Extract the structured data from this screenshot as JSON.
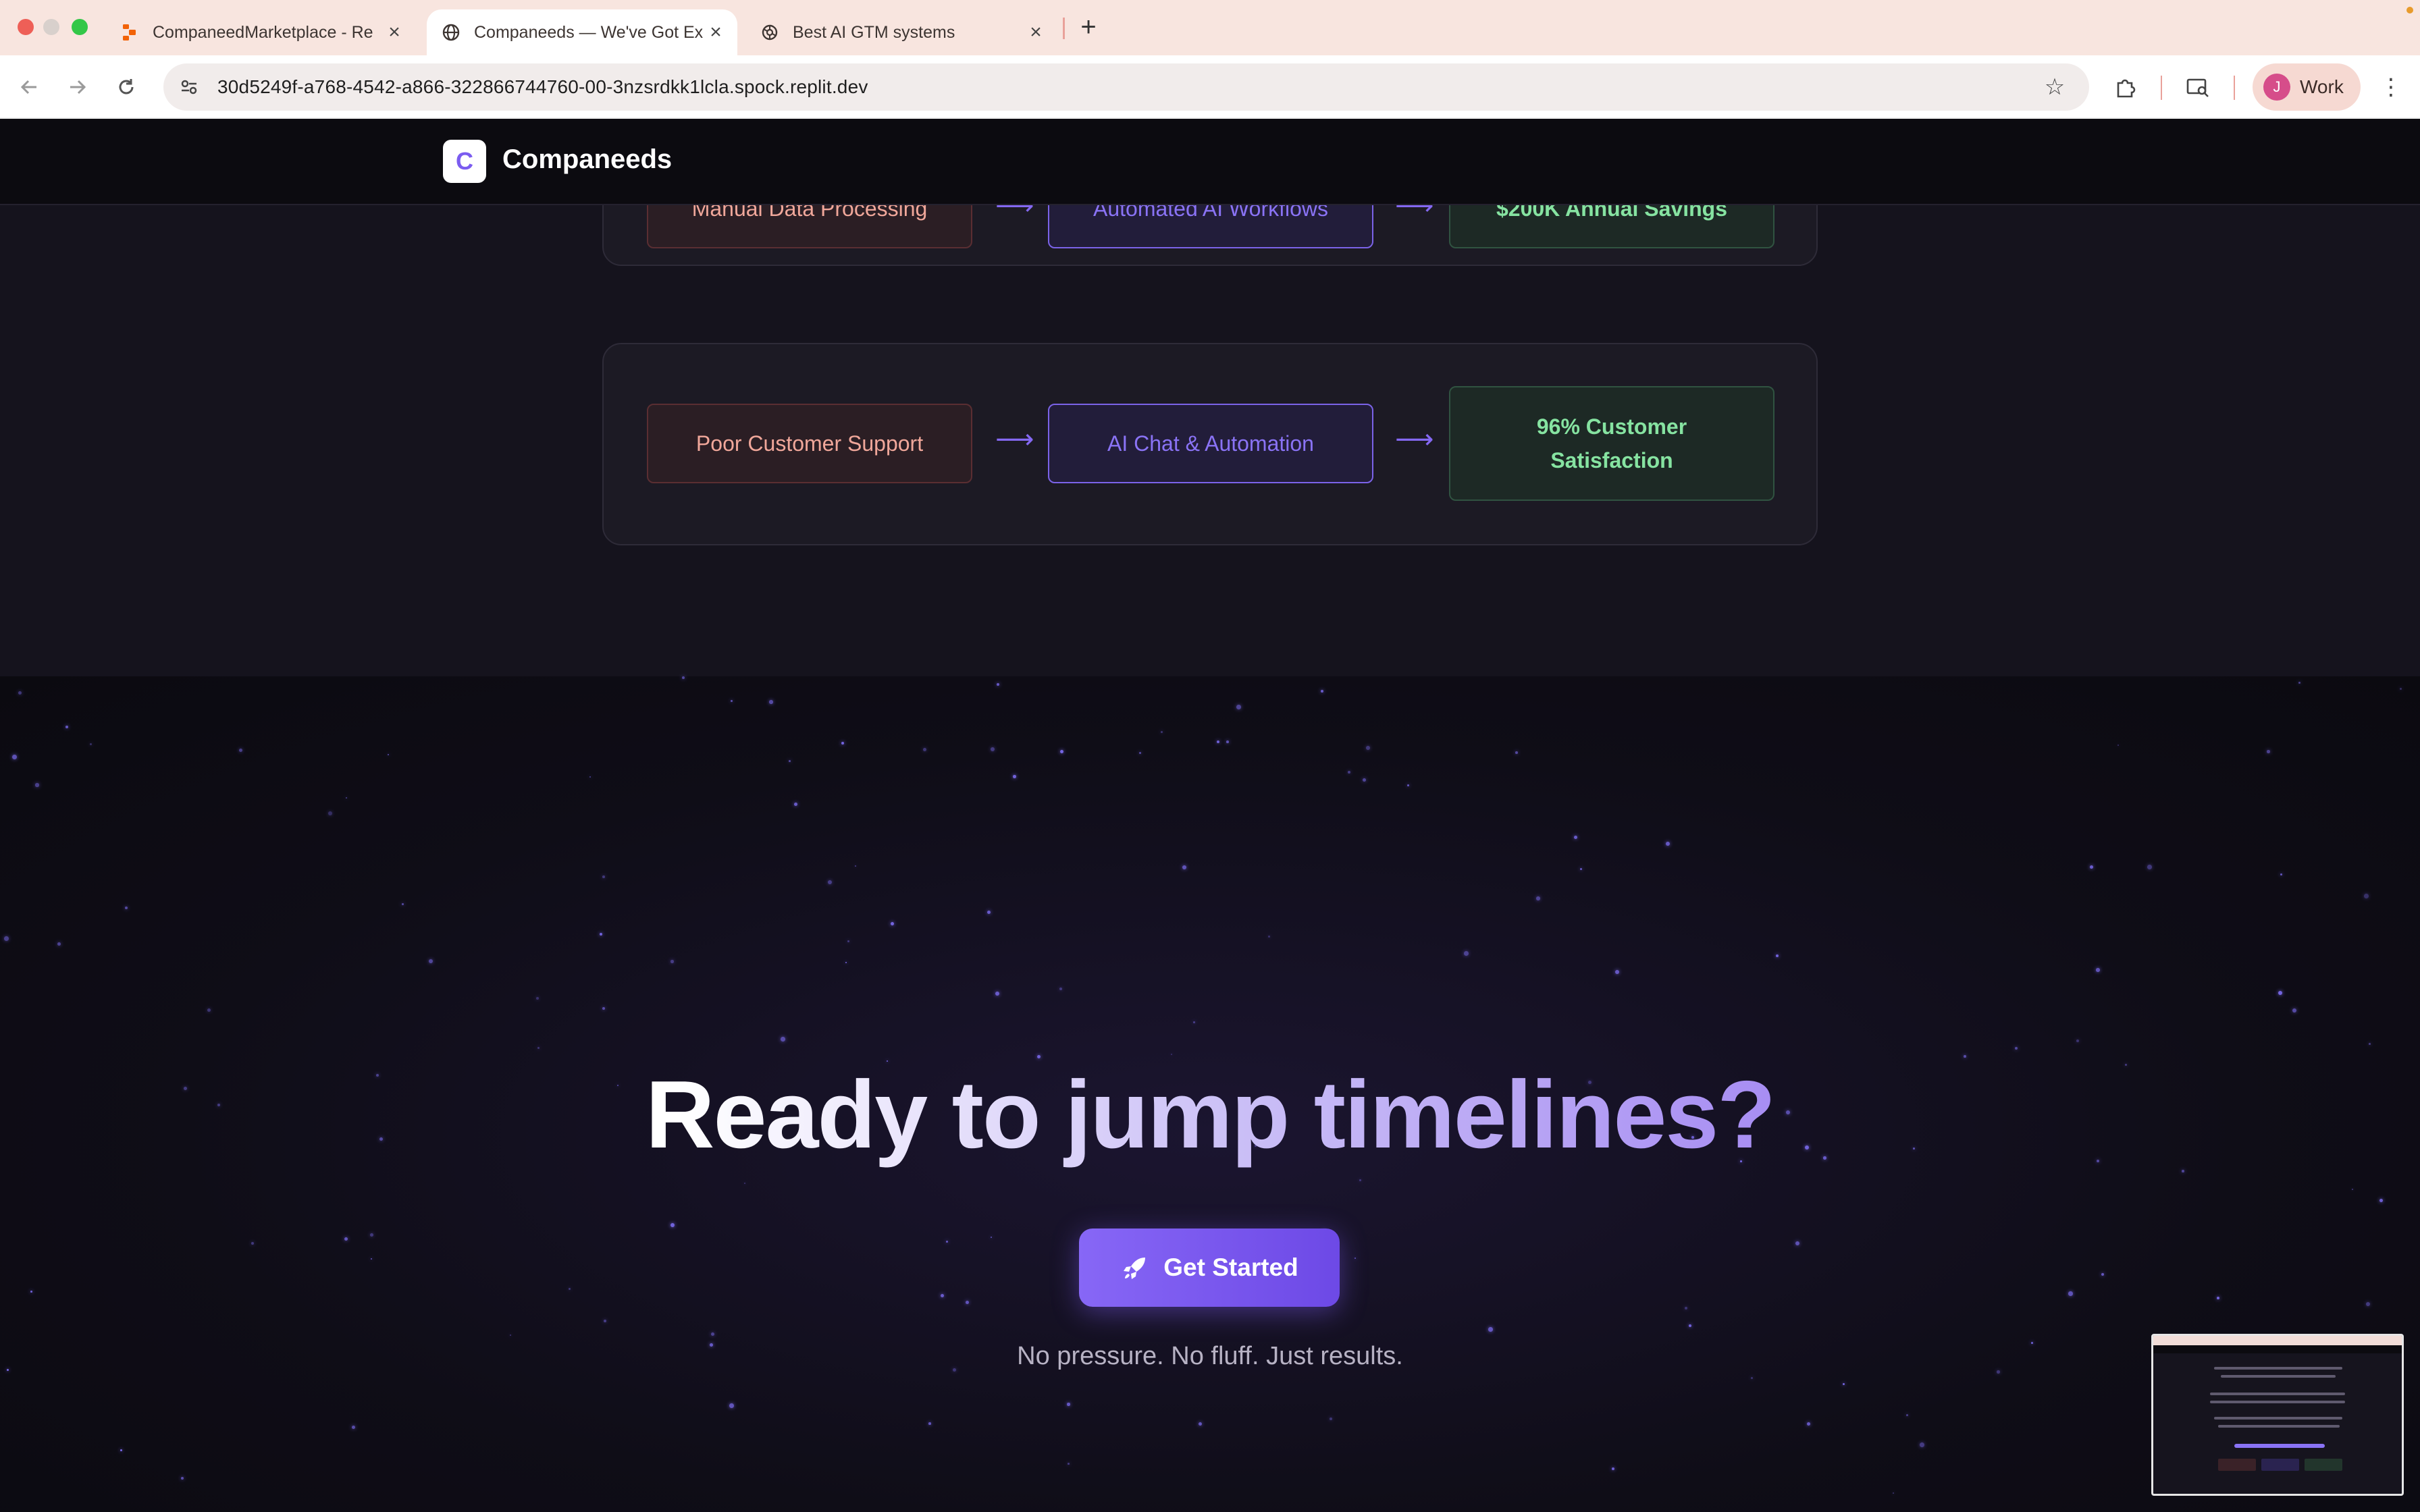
{
  "browser": {
    "tabs": [
      {
        "title": "CompaneedMarketplace - Re",
        "icon": "replit-icon",
        "active": false
      },
      {
        "title": "Companeeds — We've Got Ex",
        "icon": "globe-icon",
        "active": true
      },
      {
        "title": "Best AI GTM systems",
        "icon": "openai-icon",
        "active": false
      }
    ],
    "url": "30d5249f-a768-4542-a866-322866744760-00-3nzsrdkk1lcla.spock.replit.dev",
    "profile_initial": "J",
    "profile_label": "Work"
  },
  "site": {
    "logo_letter": "C",
    "brand": "Companeeds"
  },
  "transformations": [
    {
      "problem": "Manual Data Processing",
      "solution": "Automated AI Workflows",
      "result": "$200K Annual Savings"
    },
    {
      "problem": "Poor Customer Support",
      "solution": "AI Chat & Automation",
      "result": "96% Customer Satisfaction"
    }
  ],
  "cta": {
    "headline": "Ready to jump timelines?",
    "button_label": "Get Started",
    "tagline": "No pressure. No fluff. Just results."
  },
  "colors": {
    "accent": "#7b5cf0",
    "problem_text": "#f0a79a",
    "solution_text": "#8a73f5",
    "result_text": "#86e3a1"
  }
}
